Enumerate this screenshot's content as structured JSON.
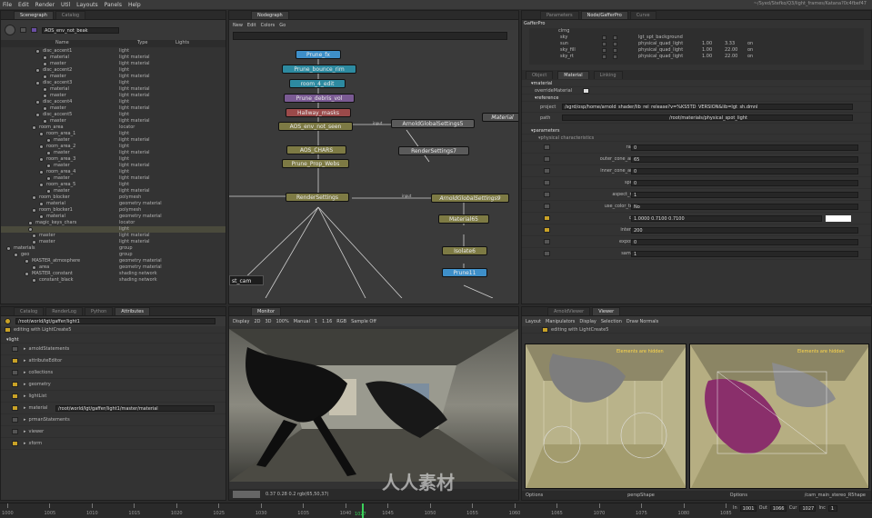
{
  "menubar": {
    "items": [
      "File",
      "Edit",
      "Render",
      "Util",
      "Layouts",
      "Panels",
      "Help"
    ],
    "title": "~/Syed/Stefko/Q3/light_frames/Katana?0c4fbef47"
  },
  "scenegraph": {
    "tabs": [
      "Scenegraph",
      "Catalog"
    ],
    "location": "AOS_env_not_beak",
    "columns": [
      "Name",
      "Type",
      "Lights"
    ],
    "rows": [
      {
        "name": "disc_accent1",
        "type": "light"
      },
      {
        "name": "material",
        "type": "light material"
      },
      {
        "name": "master",
        "type": "light material"
      },
      {
        "name": "disc_accent2",
        "type": "light"
      },
      {
        "name": "master",
        "type": "light material"
      },
      {
        "name": "disc_accent3",
        "type": "light"
      },
      {
        "name": "material",
        "type": "light material"
      },
      {
        "name": "master",
        "type": "light material"
      },
      {
        "name": "disc_accent4",
        "type": "light"
      },
      {
        "name": "master",
        "type": "light material"
      },
      {
        "name": "disc_accent5",
        "type": "light"
      },
      {
        "name": "master",
        "type": "light material"
      },
      {
        "name": "room_area",
        "type": "locator"
      },
      {
        "name": "room_area_1",
        "type": "light"
      },
      {
        "name": "master",
        "type": "light material"
      },
      {
        "name": "room_area_2",
        "type": "light"
      },
      {
        "name": "master",
        "type": "light material"
      },
      {
        "name": "room_area_3",
        "type": "light"
      },
      {
        "name": "master",
        "type": "light material"
      },
      {
        "name": "room_area_4",
        "type": "light"
      },
      {
        "name": "master",
        "type": "light material"
      },
      {
        "name": "room_area_5",
        "type": "light"
      },
      {
        "name": "master",
        "type": "light material"
      },
      {
        "name": "room_blocker",
        "type": "polymesh"
      },
      {
        "name": "material",
        "type": "geometry material"
      },
      {
        "name": "room_blocker1",
        "type": "polymesh"
      },
      {
        "name": "material",
        "type": "geometry material"
      },
      {
        "name": "magic_keys_chars",
        "type": "locator"
      },
      {
        "name": "",
        "type": "light"
      },
      {
        "name": "master",
        "type": "light material"
      },
      {
        "name": "master",
        "type": "light material"
      },
      {
        "name": "materials",
        "type": "group"
      },
      {
        "name": "geo",
        "type": "group"
      },
      {
        "name": "MASTER_atmosphere",
        "type": "geometry material"
      },
      {
        "name": "area",
        "type": "geometry material"
      },
      {
        "name": "MASTER_constant",
        "type": "shading network"
      },
      {
        "name": "constant_black",
        "type": "shading network"
      }
    ]
  },
  "nodegraph": {
    "tab": "Nodegraph",
    "menu": [
      "New",
      "Edit",
      "Colors",
      "Go"
    ],
    "nodes": {
      "prune_fx": "Prune_fx",
      "prune_bounce_rim": "Prune_bounce_rim",
      "room_4_edit": "room_4_edit",
      "prune_debris_vol": "Prune_debris_vol",
      "hallway_masks": "Hallway_masks",
      "aos_env_not_seen": "AOS_env_not_seen",
      "aos_chars": "AOS_CHARS",
      "prune_prop_webs": "Prune_Prop_Webs",
      "render_settings": "RenderSettings",
      "arnold_global_settings5": "ArnoldGlobalSettings5",
      "render_settings7": "RenderSettings7",
      "material_partial": "Material",
      "arnold_global_settings9": "ArnoldGlobalSettings9",
      "material65": "Material65",
      "isolate6": "Isolate6",
      "prune11": "Prune11",
      "camera_tag": "st_cam",
      "port_input": "input",
      "port_input2": "input"
    }
  },
  "gafferpro": {
    "tabs": [
      "Parameters",
      "Node/GafferPro",
      "Curve"
    ],
    "header": "GafferPro",
    "light_rows": [
      {
        "name": "sky",
        "type": "lgt_spt_background",
        "v1": "",
        "v2": ""
      },
      {
        "name": "sun",
        "type": "physical_quad_light",
        "v1": "1.00",
        "v2": "3.33",
        "v3": "on"
      },
      {
        "name": "sky_fill",
        "type": "physical_quad_light",
        "v1": "1.00",
        "v2": "22.00",
        "v3": "on"
      },
      {
        "name": "sky_rt",
        "type": "physical_quad_light",
        "v1": "1.00",
        "v2": "22.00",
        "v3": "on"
      }
    ],
    "root_label": "clrng",
    "subtabs": [
      "Object",
      "Material",
      "Linking"
    ],
    "section_material": "material",
    "section_reference": "reference",
    "project_label": "project",
    "project_value": "/sgrd/osp/home/arnold_shader/lib_rel_release?v=%KS5TD_VERSION&lib=lgt_sh.dmnl",
    "path_label": "path",
    "path_value": "/root/materials/physical_spot_light",
    "section_parameters": "parameters",
    "subsection": "physical characteristics",
    "params": [
      {
        "label": "radius",
        "value": "0"
      },
      {
        "label": "outer_cone_angle",
        "value": "65"
      },
      {
        "label": "inner_cone_angle",
        "value": "0"
      },
      {
        "label": "spread",
        "value": "0"
      },
      {
        "label": "aspect_ratio",
        "value": "1"
      },
      {
        "label": "use_color_temp",
        "value": "No"
      },
      {
        "label": "color",
        "value": "1.0000   0.7100   0.7100"
      },
      {
        "label": "intensity",
        "value": "200"
      },
      {
        "label": "exposure",
        "value": "0"
      },
      {
        "label": "samples",
        "value": "1"
      }
    ],
    "material_toggle_label": "overrideMaterial"
  },
  "attributes": {
    "tabs": [
      "Catalog",
      "RenderLog",
      "Python",
      "Attributes"
    ],
    "path": "/root/world/lgt/gaffer/light1",
    "editing": "editing with LightCreate5",
    "section": "light",
    "groups": [
      "arnoldStatements",
      "attributeEditor",
      "collections",
      "geometry",
      "lightList",
      "material",
      "prmanStatements",
      "viewer",
      "xform"
    ],
    "material_value": "/root/world/lgt/gaffer/light1/master/material"
  },
  "monitor": {
    "tab": "Monitor",
    "toolbar": [
      "Display",
      "2D",
      "3D",
      "100%",
      "Manual",
      "1",
      "1.16",
      "RGB",
      "Sample Off"
    ],
    "footer": "0.37  0.28  0.2  rgb(65,50,37)"
  },
  "viewers": {
    "tabs": [
      "ArnoldViewer",
      "Viewer"
    ],
    "menu": [
      "Layout",
      "Manipulators",
      "Display",
      "Selection",
      "Draw Normals"
    ],
    "editing": "editing with LightCreate5",
    "overlay_left": "Elements are hidden",
    "overlay_right": "Elements are hidden",
    "left_options": "Options",
    "left_cam": "perspShape",
    "right_options": "Options",
    "right_cam": "/cam_main_stereo_R5hape"
  },
  "timeline": {
    "ticks": [
      "1000",
      "1005",
      "1010",
      "1015",
      "1020",
      "1025",
      "1030",
      "1035",
      "1040",
      "1045",
      "1050",
      "1055",
      "1060",
      "1065",
      "1070",
      "1075",
      "1080",
      "1085"
    ],
    "current_frame": "1027",
    "in": "1001",
    "out": "1066",
    "cur": "1027",
    "inc": "1",
    "labels": [
      "In",
      "Out",
      "Cur",
      "Inc"
    ]
  },
  "watermark": "人人素材"
}
